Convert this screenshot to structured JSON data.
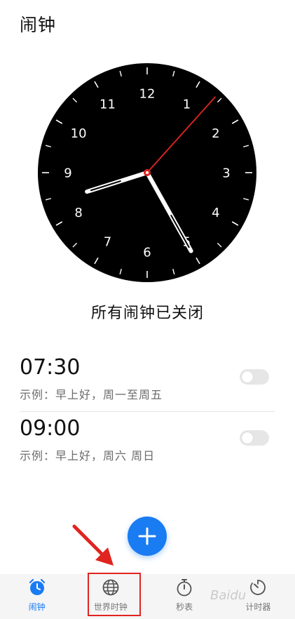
{
  "page": {
    "title": "闹钟",
    "status": "所有闹钟已关闭"
  },
  "clock": {
    "numbers": [
      "12",
      "1",
      "2",
      "3",
      "4",
      "5",
      "6",
      "7",
      "8",
      "9",
      "10",
      "11"
    ],
    "time": {
      "hour": 8,
      "minute": 25,
      "second": 7
    },
    "colors": {
      "face": "#000000",
      "hands": "#ffffff",
      "second_hand": "#e0241f"
    }
  },
  "alarms": [
    {
      "time": "07:30",
      "desc": "示例：早上好，周一至周五",
      "enabled": false
    },
    {
      "time": "09:00",
      "desc": "示例：早上好，周六 周日",
      "enabled": false
    }
  ],
  "fab": {
    "icon": "plus-icon",
    "color": "#1a7cf2"
  },
  "nav": {
    "items": [
      {
        "label": "闹钟",
        "icon": "alarm-clock-icon",
        "active": true
      },
      {
        "label": "世界时钟",
        "icon": "globe-icon",
        "active": false
      },
      {
        "label": "秒表",
        "icon": "stopwatch-icon",
        "active": false
      },
      {
        "label": "计时器",
        "icon": "timer-icon",
        "active": false
      }
    ]
  },
  "annotation": {
    "color": "#e0241f"
  },
  "watermark": "Baidu"
}
